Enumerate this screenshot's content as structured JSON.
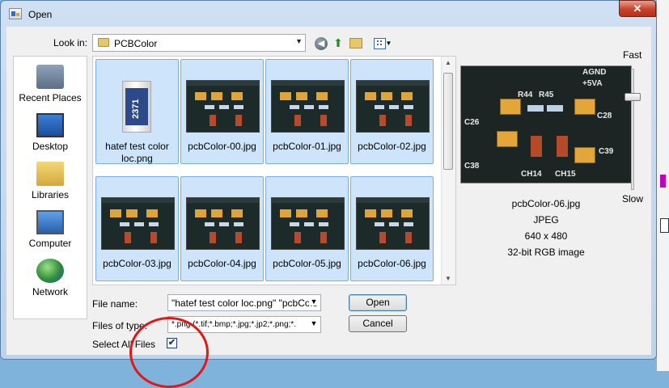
{
  "window": {
    "title": "Open",
    "close_glyph": "✕"
  },
  "toolbar": {
    "look_in_label": "Look in:",
    "look_in_value": "PCBColor",
    "icons": [
      "back-icon",
      "up-folder-icon",
      "new-folder-icon",
      "views-menu-icon"
    ]
  },
  "places": [
    {
      "label": "Recent Places",
      "icon": "recent-places-icon"
    },
    {
      "label": "Desktop",
      "icon": "desktop-icon"
    },
    {
      "label": "Libraries",
      "icon": "libraries-icon"
    },
    {
      "label": "Computer",
      "icon": "computer-icon"
    },
    {
      "label": "Network",
      "icon": "network-icon"
    }
  ],
  "files": [
    {
      "name": "hatef test color loc.png",
      "selected": true
    },
    {
      "name": "pcbColor-00.jpg",
      "selected": true
    },
    {
      "name": "pcbColor-01.jpg",
      "selected": true
    },
    {
      "name": "pcbColor-02.jpg",
      "selected": true
    },
    {
      "name": "pcbColor-03.jpg",
      "selected": true
    },
    {
      "name": "pcbColor-04.jpg",
      "selected": true
    },
    {
      "name": "pcbColor-05.jpg",
      "selected": true
    },
    {
      "name": "pcbColor-06.jpg",
      "selected": true
    }
  ],
  "thumbnail_text": {
    "resistor_code": "2371"
  },
  "preview": {
    "file_name": "pcbColor-06.jpg",
    "format": "JPEG",
    "dimensions": "640 x 480",
    "color_depth": "32-bit RGB image",
    "slider_fast": "Fast",
    "slider_slow": "Slow",
    "board_labels": [
      "AGND",
      "+5VA",
      "C26",
      "C28",
      "C39",
      "C38",
      "CH14",
      "CH15",
      "R45",
      "R44"
    ]
  },
  "form": {
    "file_name_label": "File name:",
    "file_name_value": "\"hatef test color loc.png\" \"pcbColo",
    "file_type_label": "Files of type:",
    "file_type_value": "*.png (*.tif;*.bmp;*.jpg;*.jp2;*.png;*.",
    "select_all_label": "Select All Files",
    "select_all_checked": true,
    "open_label": "Open",
    "cancel_label": "Cancel"
  },
  "colors": {
    "selection_bg": "#cde4fb",
    "annotation": "#e01818",
    "close_button": "#c7432a"
  }
}
